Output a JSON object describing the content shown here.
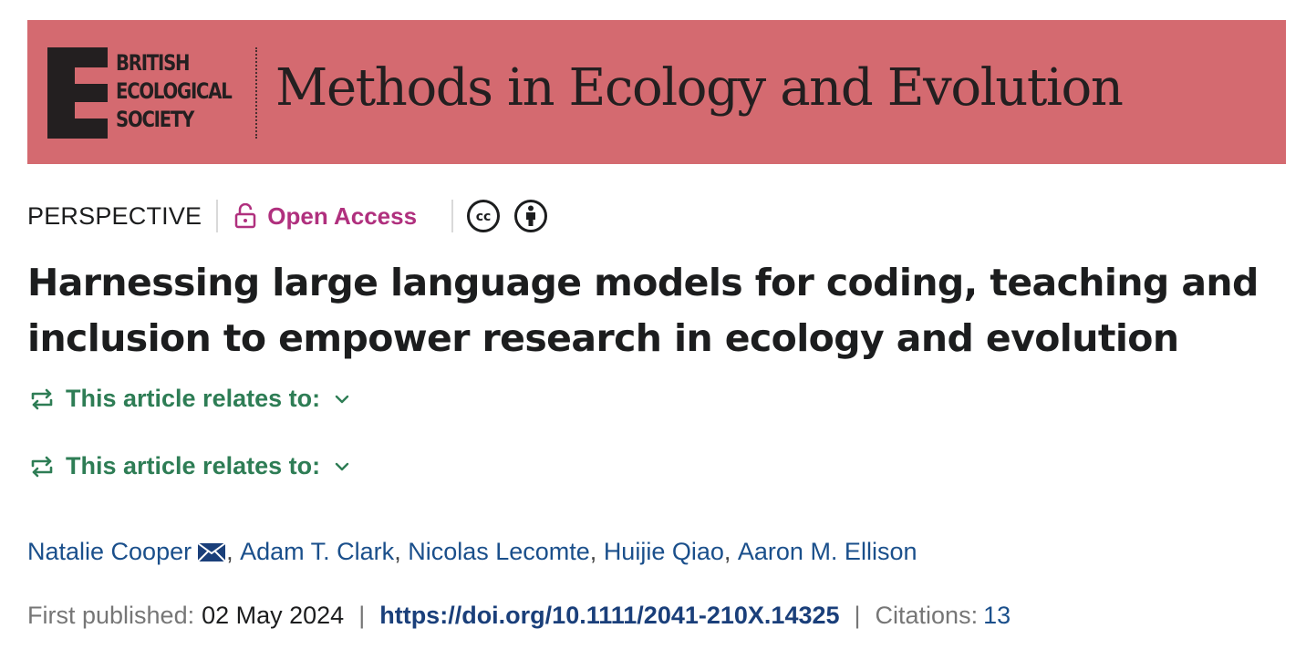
{
  "banner": {
    "society_lines": [
      "BRITISH",
      "ECOLOGICAL",
      "SOCIETY"
    ],
    "journal_title": "Methods in Ecology and Evolution",
    "background_color": "#d46a70"
  },
  "meta": {
    "article_type": "PERSPECTIVE",
    "open_access_label": "Open Access",
    "open_access_color": "#b0307e",
    "license_icons": [
      "creative-commons-icon",
      "attribution-icon"
    ]
  },
  "article": {
    "title_line1": "Harnessing large language models for coding, teaching and",
    "title_line2": "inclusion to empower research in ecology and evolution"
  },
  "relates": [
    {
      "label": "This article relates to:"
    },
    {
      "label": "This article relates to:"
    }
  ],
  "authors": [
    {
      "name": "Natalie Cooper",
      "corresponding": true
    },
    {
      "name": "Adam T. Clark"
    },
    {
      "name": "Nicolas Lecomte"
    },
    {
      "name": "Huijie Qiao"
    },
    {
      "name": "Aaron M. Ellison"
    }
  ],
  "publication": {
    "first_published_label": "First published:",
    "first_published_date": "02 May 2024",
    "separator": "|",
    "doi": "https://doi.org/10.1111/2041-210X.14325",
    "citations_label": "Citations:",
    "citations_count": "13"
  },
  "colors": {
    "link_green": "#2e7d55",
    "author_blue": "#1a4f8b",
    "doi_blue": "#1a3f7a"
  }
}
